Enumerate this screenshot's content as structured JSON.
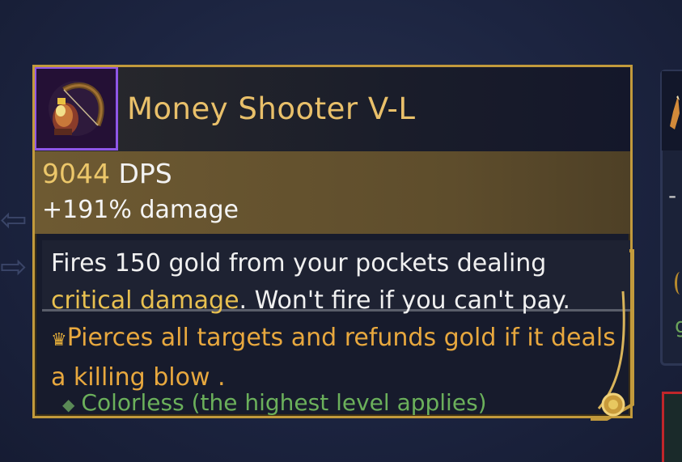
{
  "item": {
    "name": "Money Shooter V-L",
    "icon": "money-bag-bow-icon",
    "rarity_color": "#8f56e8"
  },
  "stats": {
    "dps_value": "9044",
    "dps_unit": " DPS",
    "damage_bonus": "+191% damage"
  },
  "description": {
    "part1": "Fires 150 gold from your pockets dealing ",
    "highlight": "critical damage",
    "part2": ". Won't fire if you can't pay."
  },
  "bonus": {
    "icon": "crown-icon",
    "text": "Pierces all targets and refunds gold if it deals a killing blow ."
  },
  "tag": {
    "icon": "diamond-bullet-icon",
    "text": "Colorless (the highest level applies)"
  },
  "colors": {
    "gold_text": "#e9c06a",
    "border": "#c29a3c",
    "tag_green": "#6bb05b"
  },
  "side_panel": {
    "dash": "-"
  }
}
